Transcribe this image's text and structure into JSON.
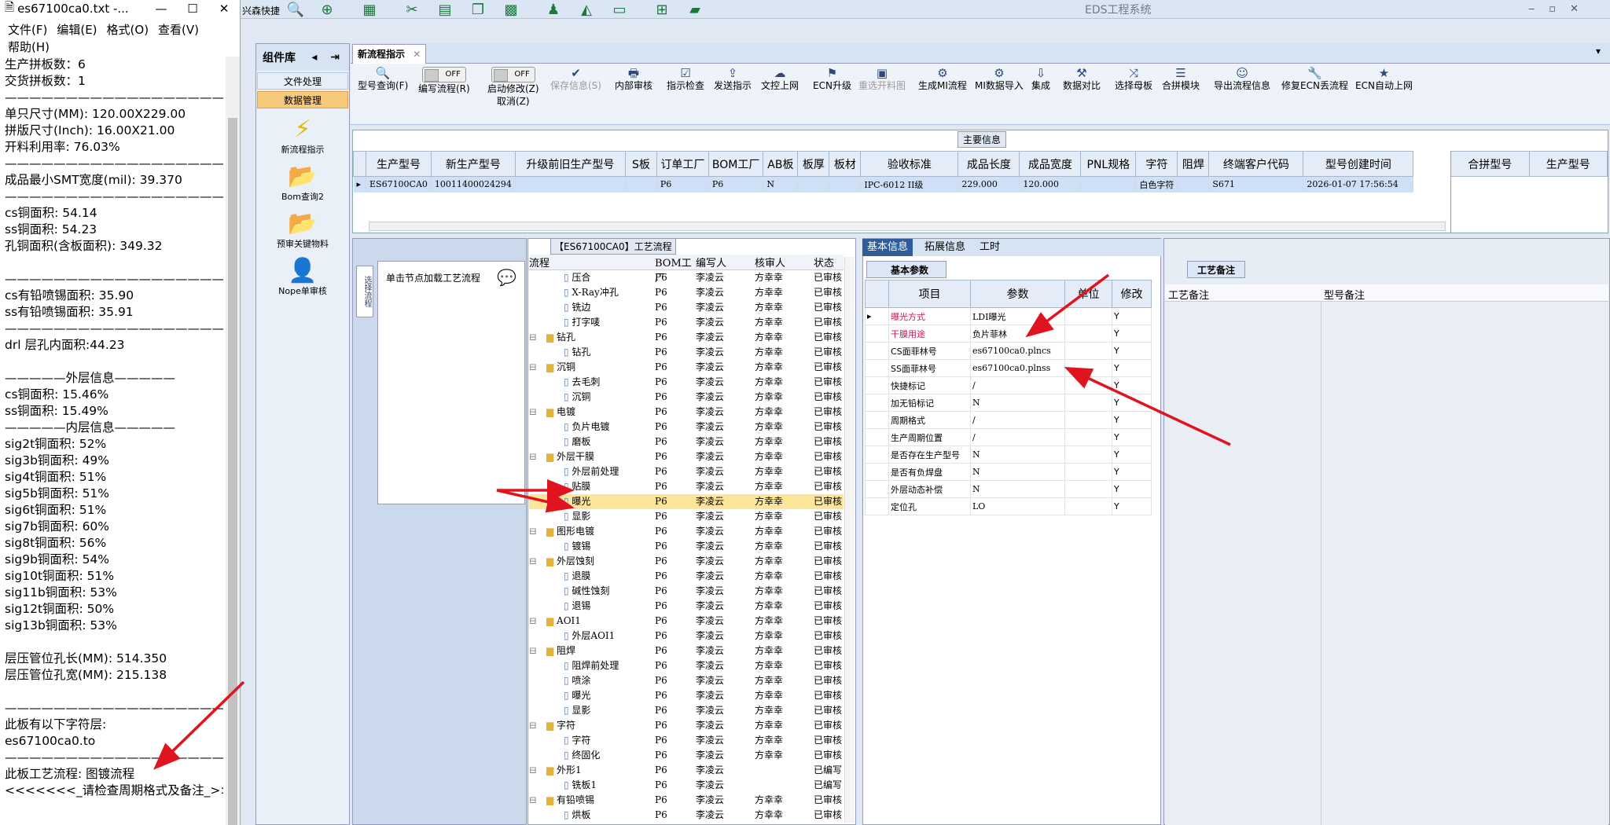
{
  "notepad": {
    "title": "es67100ca0.txt -...",
    "menu": [
      "文件(F)",
      "编辑(E)",
      "格式(O)",
      "查看(V)",
      "帮助(H)"
    ],
    "lines": [
      "生产拼板数：6",
      "交货拼板数：1",
      "—————————————————————",
      "单只尺寸(MM): 120.00X229.00",
      "拼版尺寸(Inch): 16.00X21.00",
      "开料利用率: 76.03%",
      "—————————————————————",
      "成品最小SMT宽度(mil): 39.370",
      "—————————————————————",
      "cs铜面积: 54.14",
      "ss铜面积: 54.23",
      "孔铜面积(含板面积): 349.32",
      "",
      "—————————————————————",
      "cs有铅喷锡面积: 35.90",
      "ss有铅喷锡面积: 35.91",
      "—————————————————————",
      "drl          层孔内面积:44.23",
      "",
      "—————外层信息—————",
      "cs铜面积: 15.46%",
      "ss铜面积: 15.49%",
      "—————内层信息—————",
      "sig2t铜面积: 52%",
      "sig3b铜面积: 49%",
      "sig4t铜面积: 51%",
      "sig5b铜面积: 51%",
      "sig6t铜面积: 51%",
      "sig7b铜面积: 60%",
      "sig8t铜面积: 56%",
      "sig9b铜面积: 54%",
      "sig10t铜面积: 51%",
      "sig11b铜面积: 53%",
      "sig12t铜面积: 50%",
      "sig13b铜面积: 53%",
      "",
      "层压管位孔长(MM): 514.350",
      "层压管位孔宽(MM): 215.138",
      "",
      "—————————————————————",
      "此板有以下字符层:",
      "es67100ca0.to",
      "—————————————————————",
      "此板工艺流程:  图镀流程",
      "<<<<<<<_请检查周期格式及备注_>>"
    ]
  },
  "app": {
    "title": "EDS工程系统",
    "top_label": "兴森快捷",
    "sidebar": {
      "title": "组件库",
      "sections": [
        "文件处理",
        "数据管理"
      ],
      "items": [
        "新流程指示",
        "Bom查询2",
        "预审关键物料",
        "Nope单审核"
      ]
    },
    "tab": "新流程指示",
    "ribbon": [
      {
        "label": "型号查询(F)",
        "icon": "🔍"
      },
      {
        "label": "编写流程(R)",
        "toggle": "OFF"
      },
      {
        "label": "启动修改(Z)\n取消(Z)",
        "toggle": "OFF"
      },
      {
        "label": "保存信息(S)",
        "icon": "✔",
        "disabled": true
      },
      {
        "label": "内部审核",
        "icon": "🖶"
      },
      {
        "label": "指示检查",
        "icon": "☑"
      },
      {
        "label": "发送指示",
        "icon": "⇪"
      },
      {
        "label": "文控上网",
        "icon": "☁"
      },
      {
        "label": "ECN升级",
        "icon": "⚑"
      },
      {
        "label": "重选开料图",
        "icon": "▣",
        "disabled": true
      },
      {
        "label": "生成MI流程",
        "icon": "⚙"
      },
      {
        "label": "MI数据导入",
        "icon": "⚙"
      },
      {
        "label": "集成",
        "icon": "⇩"
      },
      {
        "label": "数据对比",
        "icon": "⚒"
      },
      {
        "label": "选择母板",
        "icon": "⤨"
      },
      {
        "label": "合拼模块",
        "icon": "☰"
      },
      {
        "label": "导出流程信息",
        "icon": "☺"
      },
      {
        "label": "修复ECN丢流程",
        "icon": "🔧"
      },
      {
        "label": "ECN自动上网",
        "icon": "★"
      }
    ],
    "main_info": {
      "label": "主要信息",
      "headers": [
        "生产型号",
        "新生产型号",
        "升级前旧生产型号",
        "S板",
        "订单工厂",
        "BOM工厂",
        "AB板",
        "板厚",
        "板材",
        "验收标准",
        "成品长度",
        "成品宽度",
        "PNL规格",
        "字符",
        "阻焊",
        "终端客户代码",
        "型号创建时间"
      ],
      "row": [
        "ES67100CA0",
        "10011400024294",
        "",
        "",
        "P6",
        "P6",
        "N",
        "",
        "",
        "IPC-6012 II级",
        "229.000",
        "120.000",
        "",
        "白色字符",
        "",
        "S671",
        "2026-01-07 17:56:54"
      ],
      "side_headers": [
        "合拼型号",
        "生产型号"
      ]
    },
    "left_panel": {
      "note": "单击节点加载工艺流程",
      "tab": "选择流程"
    },
    "tree": {
      "label": "【ES67100CA0】工艺流程",
      "headers": [
        "流程",
        "BOM工厂",
        "编写人",
        "核审人",
        "状态"
      ],
      "rows": [
        {
          "lvl": 2,
          "name": "压合",
          "f": "P6",
          "w": "李凌云",
          "r": "方幸幸",
          "s": "已审核"
        },
        {
          "lvl": 2,
          "name": "X-Ray冲孔",
          "f": "P6",
          "w": "李凌云",
          "r": "方幸幸",
          "s": "已审核"
        },
        {
          "lvl": 2,
          "name": "铣边",
          "f": "P6",
          "w": "李凌云",
          "r": "方幸幸",
          "s": "已审核"
        },
        {
          "lvl": 2,
          "name": "打字唛",
          "f": "P6",
          "w": "李凌云",
          "r": "方幸幸",
          "s": "已审核"
        },
        {
          "lvl": 1,
          "name": "钻孔",
          "f": "P6",
          "w": "李凌云",
          "r": "方幸幸",
          "s": "已审核"
        },
        {
          "lvl": 2,
          "name": "钻孔",
          "f": "P6",
          "w": "李凌云",
          "r": "方幸幸",
          "s": "已审核"
        },
        {
          "lvl": 1,
          "name": "沉铜",
          "f": "P6",
          "w": "李凌云",
          "r": "方幸幸",
          "s": "已审核"
        },
        {
          "lvl": 2,
          "name": "去毛刺",
          "f": "P6",
          "w": "李凌云",
          "r": "方幸幸",
          "s": "已审核"
        },
        {
          "lvl": 2,
          "name": "沉铜",
          "f": "P6",
          "w": "李凌云",
          "r": "方幸幸",
          "s": "已审核"
        },
        {
          "lvl": 1,
          "name": "电镀",
          "f": "P6",
          "w": "李凌云",
          "r": "方幸幸",
          "s": "已审核"
        },
        {
          "lvl": 2,
          "name": "负片电镀",
          "f": "P6",
          "w": "李凌云",
          "r": "方幸幸",
          "s": "已审核"
        },
        {
          "lvl": 2,
          "name": "磨板",
          "f": "P6",
          "w": "李凌云",
          "r": "方幸幸",
          "s": "已审核"
        },
        {
          "lvl": 1,
          "name": "外层干膜",
          "f": "P6",
          "w": "李凌云",
          "r": "方幸幸",
          "s": "已审核"
        },
        {
          "lvl": 2,
          "name": "外层前处理",
          "f": "P6",
          "w": "李凌云",
          "r": "方幸幸",
          "s": "已审核"
        },
        {
          "lvl": 2,
          "name": "贴膜",
          "f": "P6",
          "w": "李凌云",
          "r": "方幸幸",
          "s": "已审核"
        },
        {
          "lvl": 2,
          "name": "曝光",
          "f": "P6",
          "w": "李凌云",
          "r": "方幸幸",
          "s": "已审核",
          "sel": true
        },
        {
          "lvl": 2,
          "name": "显影",
          "f": "P6",
          "w": "李凌云",
          "r": "方幸幸",
          "s": "已审核"
        },
        {
          "lvl": 1,
          "name": "图形电镀",
          "f": "P6",
          "w": "李凌云",
          "r": "方幸幸",
          "s": "已审核"
        },
        {
          "lvl": 2,
          "name": "镀锡",
          "f": "P6",
          "w": "李凌云",
          "r": "方幸幸",
          "s": "已审核"
        },
        {
          "lvl": 1,
          "name": "外层蚀刻",
          "f": "P6",
          "w": "李凌云",
          "r": "方幸幸",
          "s": "已审核"
        },
        {
          "lvl": 2,
          "name": "退膜",
          "f": "P6",
          "w": "李凌云",
          "r": "方幸幸",
          "s": "已审核"
        },
        {
          "lvl": 2,
          "name": "碱性蚀刻",
          "f": "P6",
          "w": "李凌云",
          "r": "方幸幸",
          "s": "已审核"
        },
        {
          "lvl": 2,
          "name": "退锡",
          "f": "P6",
          "w": "李凌云",
          "r": "方幸幸",
          "s": "已审核"
        },
        {
          "lvl": 1,
          "name": "AOI1",
          "f": "P6",
          "w": "李凌云",
          "r": "方幸幸",
          "s": "已审核"
        },
        {
          "lvl": 2,
          "name": "外层AOI1",
          "f": "P6",
          "w": "李凌云",
          "r": "方幸幸",
          "s": "已审核"
        },
        {
          "lvl": 1,
          "name": "阻焊",
          "f": "P6",
          "w": "李凌云",
          "r": "方幸幸",
          "s": "已审核"
        },
        {
          "lvl": 2,
          "name": "阻焊前处理",
          "f": "P6",
          "w": "李凌云",
          "r": "方幸幸",
          "s": "已审核"
        },
        {
          "lvl": 2,
          "name": "喷涂",
          "f": "P6",
          "w": "李凌云",
          "r": "方幸幸",
          "s": "已审核"
        },
        {
          "lvl": 2,
          "name": "曝光",
          "f": "P6",
          "w": "李凌云",
          "r": "方幸幸",
          "s": "已审核"
        },
        {
          "lvl": 2,
          "name": "显影",
          "f": "P6",
          "w": "李凌云",
          "r": "方幸幸",
          "s": "已审核"
        },
        {
          "lvl": 1,
          "name": "字符",
          "f": "P6",
          "w": "李凌云",
          "r": "方幸幸",
          "s": "已审核"
        },
        {
          "lvl": 2,
          "name": "字符",
          "f": "P6",
          "w": "李凌云",
          "r": "方幸幸",
          "s": "已审核"
        },
        {
          "lvl": 2,
          "name": "终固化",
          "f": "P6",
          "w": "李凌云",
          "r": "方幸幸",
          "s": "已审核"
        },
        {
          "lvl": 1,
          "name": "外形1",
          "f": "P6",
          "w": "李凌云",
          "r": "",
          "s": "已编写"
        },
        {
          "lvl": 2,
          "name": "铣板1",
          "f": "P6",
          "w": "李凌云",
          "r": "",
          "s": "已编写"
        },
        {
          "lvl": 1,
          "name": "有铅喷锡",
          "f": "P6",
          "w": "李凌云",
          "r": "方幸幸",
          "s": "已审核"
        },
        {
          "lvl": 2,
          "name": "烘板",
          "f": "P6",
          "w": "李凌云",
          "r": "方幸幸",
          "s": "已审核"
        }
      ]
    },
    "detail": {
      "tabs": [
        "基本信息",
        "拓展信息",
        "工时"
      ],
      "sub_tab": "基本参数",
      "headers": [
        "项目",
        "参数",
        "单位",
        "修改"
      ],
      "rows": [
        {
          "k": "曝光方式",
          "v": "LDI曝光",
          "m": "Y",
          "red": true
        },
        {
          "k": "干膜用途",
          "v": "负片菲林",
          "m": "Y",
          "red": true
        },
        {
          "k": "CS面菲林号",
          "v": "es67100ca0.plncs",
          "m": "Y"
        },
        {
          "k": "SS面菲林号",
          "v": "es67100ca0.plnss",
          "m": "Y"
        },
        {
          "k": "快捷标记",
          "v": "/",
          "m": "Y"
        },
        {
          "k": "加无铅标记",
          "v": "N",
          "m": "Y"
        },
        {
          "k": "周期格式",
          "v": "/",
          "m": "Y"
        },
        {
          "k": "生产周期位置",
          "v": "/",
          "m": "Y"
        },
        {
          "k": "是否存在生产型号",
          "v": "N",
          "m": "Y"
        },
        {
          "k": "是否有负焊盘",
          "v": "N",
          "m": "Y"
        },
        {
          "k": "外层动态补偿",
          "v": "N",
          "m": "Y"
        },
        {
          "k": "定位孔",
          "v": "LO",
          "m": "Y"
        }
      ]
    },
    "remark": {
      "label": "工艺备注",
      "headers": [
        "工艺备注",
        "型号备注"
      ]
    }
  },
  "colors": {
    "arrow": "#e0141e",
    "selected": "#fde59a",
    "accent": "#2f5d9c"
  }
}
